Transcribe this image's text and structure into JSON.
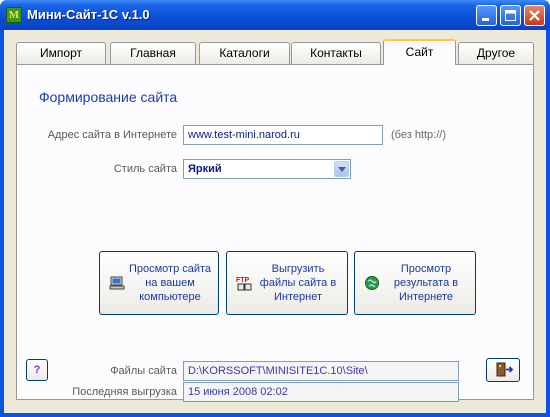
{
  "window": {
    "title": "Мини-Сайт-1С v.1.0",
    "icon_letter": "M"
  },
  "tabs": [
    {
      "label": "Импорт"
    },
    {
      "label": "Главная"
    },
    {
      "label": "Каталоги"
    },
    {
      "label": "Контакты"
    },
    {
      "label": "Сайт"
    },
    {
      "label": "Другое"
    }
  ],
  "active_tab": "Сайт",
  "section": {
    "title": "Формирование сайта"
  },
  "site_address": {
    "label": "Адрес сайта в Интернете",
    "value": "www.test-mini.narod.ru",
    "hint": "(без http://)"
  },
  "site_style": {
    "label": "Стиль сайта",
    "value": "Яркий"
  },
  "actions": [
    {
      "label": "Просмотр сайта\nна вашем\nкомпьютере",
      "icon": "computer-icon"
    },
    {
      "label": "Выгрузить\nфайлы сайта в\nИнтернет",
      "icon": "ftp-icon"
    },
    {
      "label": "Просмотр\nрезультата в\nИнтернете",
      "icon": "globe-icon"
    }
  ],
  "site_files": {
    "label": "Файлы сайта",
    "value": "D:\\KORSSOFT\\MINISITE1C.10\\Site\\"
  },
  "last_upload": {
    "label": "Последняя выгрузка",
    "value": "15 июня 2008 02:02"
  },
  "help_button": {
    "label": "?"
  },
  "exit_button": {
    "icon": "exit-door-icon"
  }
}
